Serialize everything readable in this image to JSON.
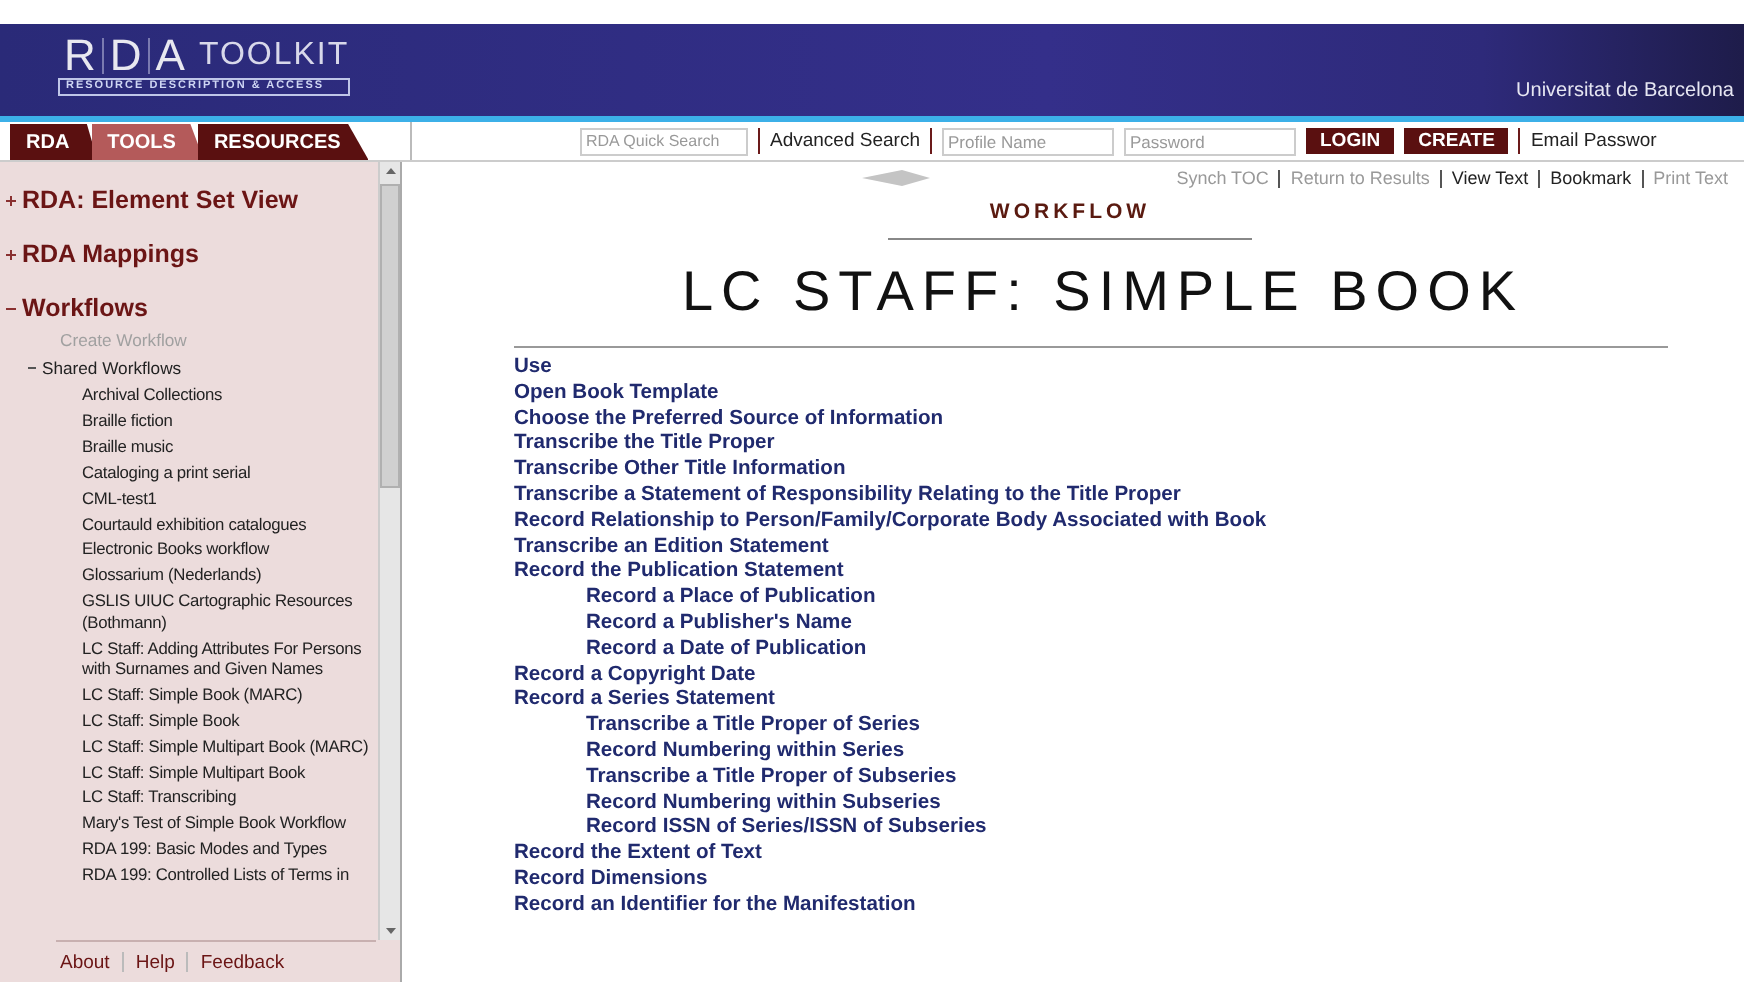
{
  "header": {
    "logo_letters": [
      "R",
      "D",
      "A"
    ],
    "logo_word": "TOOLKIT",
    "tagline": "RESOURCE DESCRIPTION & ACCESS",
    "institution": "Universitat de Barcelona"
  },
  "tabs": [
    {
      "label": "RDA",
      "selected": false
    },
    {
      "label": "TOOLS",
      "selected": true
    },
    {
      "label": "RESOURCES",
      "selected": false
    }
  ],
  "toolbar": {
    "quick_search": {
      "placeholder": "RDA Quick Search"
    },
    "advanced_search": "Advanced Search",
    "profile": {
      "placeholder": "Profile Name"
    },
    "password": {
      "placeholder": "Password"
    },
    "buttons": [
      "LOGIN",
      "CREATE"
    ],
    "email_link": "Email Passwor"
  },
  "sidebar": {
    "sections": [
      {
        "label": "RDA: Element Set View",
        "expanded": false
      },
      {
        "label": "RDA Mappings",
        "expanded": false
      },
      {
        "label": "Workflows",
        "expanded": true,
        "children": [
          {
            "label": "Create Workflow",
            "disabled": true
          },
          {
            "label": "Shared Workflows",
            "disabled": false,
            "expanded": true,
            "children": [
              "Archival Collections",
              "Braille fiction",
              "Braille music",
              "Cataloging a print serial",
              "CML-test1",
              "Courtauld exhibition catalogues",
              "Electronic Books workflow",
              "Glossarium (Nederlands)",
              "GSLIS UIUC Cartographic Resources (Bothmann)",
              "LC Staff: Adding Attributes For Persons with Surnames and Given Names",
              "LC Staff: Simple Book (MARC)",
              "LC Staff: Simple Book",
              "LC Staff: Simple Multipart Book (MARC)",
              "LC Staff: Simple Multipart Book",
              "LC Staff: Transcribing",
              "Mary's Test of Simple Book Workflow",
              "RDA 199: Basic Modes and Types",
              "RDA 199: Controlled Lists of Terms in"
            ]
          }
        ]
      }
    ],
    "footer_links": [
      "About",
      "Help",
      "Feedback"
    ]
  },
  "doc_links": [
    {
      "label": "Synch TOC",
      "disabled": true
    },
    {
      "label": "Return to Results",
      "disabled": true
    },
    {
      "label": "View Text",
      "disabled": false
    },
    {
      "label": "Bookmark",
      "disabled": false
    },
    {
      "label": "Print Text",
      "disabled": true
    }
  ],
  "section_label": "WORKFLOW",
  "title": "LC STAFF: SIMPLE BOOK",
  "steps": [
    {
      "label": "Use"
    },
    {
      "label": "Open Book Template"
    },
    {
      "label": "Choose the Preferred Source of Information"
    },
    {
      "label": "Transcribe the Title Proper"
    },
    {
      "label": "Transcribe Other Title Information"
    },
    {
      "label": "Transcribe a Statement of Responsibility Relating to the Title Proper"
    },
    {
      "label": "Record Relationship to Person/Family/Corporate Body Associated with Book"
    },
    {
      "label": "Transcribe an Edition Statement"
    },
    {
      "label": "Record the Publication Statement",
      "children": [
        {
          "label": "Record a Place of Publication"
        },
        {
          "label": "Record a Publisher's Name"
        },
        {
          "label": "Record a Date of Publication"
        }
      ]
    },
    {
      "label": "Record a Copyright Date"
    },
    {
      "label": "Record a Series Statement",
      "children": [
        {
          "label": "Transcribe a Title Proper of Series"
        },
        {
          "label": "Record Numbering within Series"
        },
        {
          "label": "Transcribe a Title Proper of Subseries"
        },
        {
          "label": "Record Numbering within Subseries"
        },
        {
          "label": "Record ISSN of Series/ISSN of Subseries"
        }
      ]
    },
    {
      "label": "Record the Extent of Text"
    },
    {
      "label": "Record Dimensions"
    },
    {
      "label": "Record an Identifier for the Manifestation"
    }
  ]
}
